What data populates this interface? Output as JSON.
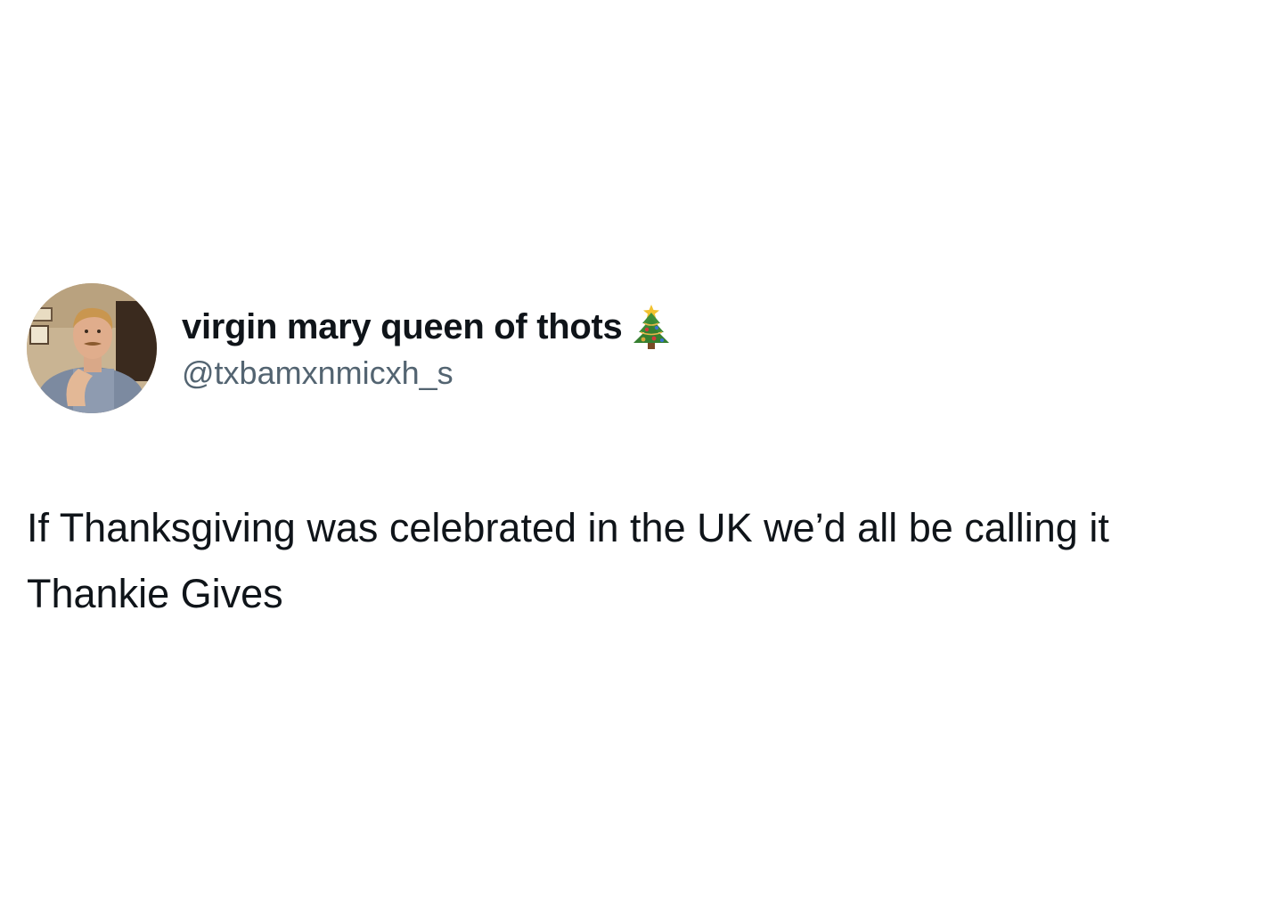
{
  "tweet": {
    "author": {
      "display_name": "virgin mary queen of thots",
      "name_emoji": "christmas-tree-icon",
      "handle": "@txbamxnmicxh_s",
      "avatar": "profile-photo"
    },
    "text": "If Thanksgiving was celebrated in the UK we’d all be calling it Thankie Gives"
  },
  "colors": {
    "text_primary": "#0f1419",
    "text_secondary": "#536471",
    "background": "#ffffff"
  }
}
